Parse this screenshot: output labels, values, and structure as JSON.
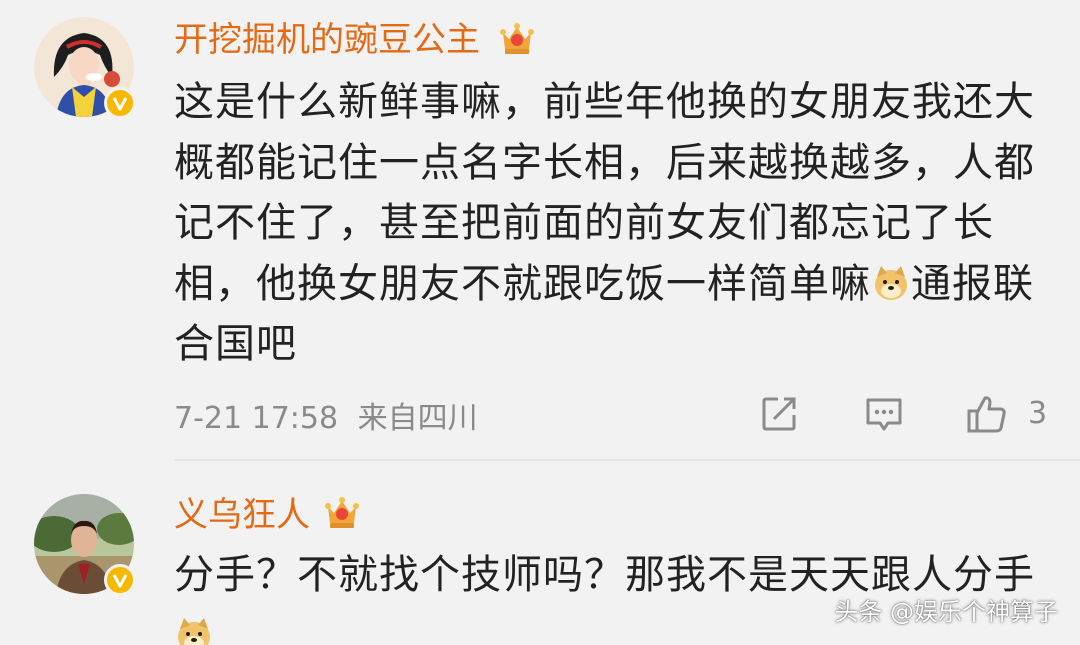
{
  "colors": {
    "username": "#e66a14",
    "text": "#222222",
    "meta": "#8a8a8a",
    "background": "#f2f2f2",
    "verified_badge": "#f6b800"
  },
  "comments": [
    {
      "username": "开挖掘机的豌豆公主",
      "avatar_icon": "snow-white-avatar",
      "badge_icon": "crown-vip-icon",
      "verified_icon": "verified-v-icon",
      "text_lines": [
        "这是什么新鲜事嘛，前些年他换的女朋友我还大",
        "概都能记住一点名字长相，后来越换越多，人都",
        "记不住了，甚至把前面的前女友们都忘记了长",
        "相，他换女朋友不就跟吃饭一样简单嘛",
        "通报联",
        "合国吧"
      ],
      "timestamp": "7-21 17:58",
      "location": "来自四川",
      "actions": {
        "share_icon": "share-icon",
        "reply_icon": "comment-icon",
        "like_icon": "thumbs-up-icon",
        "like_count": "3"
      }
    },
    {
      "username": "义乌狂人",
      "avatar_icon": "man-in-suit-avatar",
      "badge_icon": "crown-vip-icon",
      "verified_icon": "verified-v-icon",
      "text_lines": [
        "分手？不就找个技师吗？那我不是天天跟人分手"
      ]
    }
  ],
  "watermark": "头条 @娱乐个神算子"
}
